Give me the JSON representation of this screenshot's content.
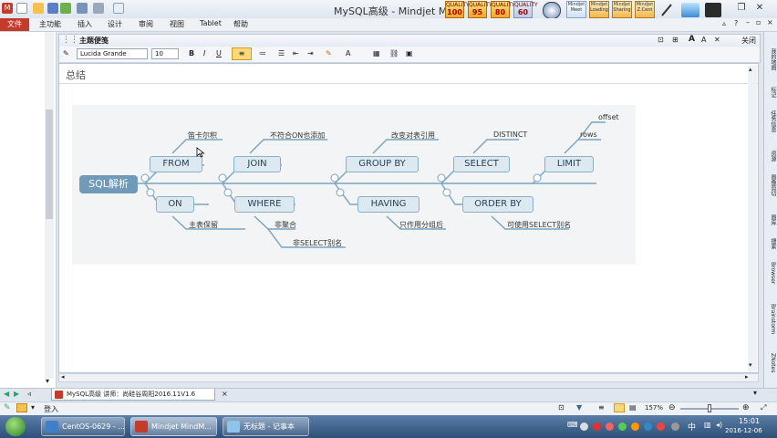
{
  "window": {
    "title": "MySQL高级 - Mindjet M",
    "quality_badges": [
      {
        "top": "QUALITY",
        "value": "100"
      },
      {
        "top": "QUALITY",
        "value": "95"
      },
      {
        "top": "QUALITY",
        "value": "80"
      },
      {
        "top": "QUALITY",
        "value": "60"
      }
    ],
    "toolbar_icons": [
      "Mindjet Meet",
      "Mindjet Loading",
      "Mindjet Sharing",
      "Mindjet Z.Cent"
    ]
  },
  "menu": {
    "file": "文件",
    "items": [
      "主功能",
      "插入",
      "设计",
      "审阅",
      "视图",
      "Tablet",
      "帮助"
    ]
  },
  "notes": {
    "title": "主题便笺",
    "close": "关闭",
    "font_name": "Lucida Grande",
    "font_size": "10",
    "summary": "总结"
  },
  "mindmap": {
    "center": "SQL解析",
    "top_nodes": [
      {
        "label": "FROM",
        "note": "笛卡尔积"
      },
      {
        "label": "JOIN",
        "note": "不符合ON也添加"
      },
      {
        "label": "GROUP BY",
        "note": "改变对表引用"
      },
      {
        "label": "SELECT",
        "note": "DISTINCT"
      },
      {
        "label": "LIMIT",
        "note": "rows",
        "note2": "offset"
      }
    ],
    "bottom_nodes": [
      {
        "label": "ON",
        "note": "主表保留"
      },
      {
        "label": "WHERE",
        "note": "非聚合",
        "note2": "非SELECT别名"
      },
      {
        "label": "HAVING",
        "note": "只作用分组后"
      },
      {
        "label": "ORDER BY",
        "note": "可使用SELECT别名"
      }
    ]
  },
  "right_tabs": [
    "我的地图",
    "标记",
    "任务信息",
    "资源",
    "图像剪切",
    "图库",
    "搜索",
    "Browser",
    "Brainstorm",
    "ZNotes"
  ],
  "doc_tab": "MySQL高级 讲师：尚硅谷周阳2016.11V1.6",
  "status": {
    "login": "登入",
    "zoom": "157%"
  },
  "taskbar": {
    "tasks": [
      "CentOS-0629 - ...",
      "Mindjet MindM...",
      "无标题 - 记事本"
    ],
    "time": "15:01",
    "date": "2016-12-06",
    "lang": "中"
  },
  "colors": {
    "node_fill": "#dde9f1",
    "node_border": "#8cafc6",
    "center_fill": "#6f9ab8",
    "branch": "#7aa3bf",
    "file_tab": "#c33b2b"
  }
}
